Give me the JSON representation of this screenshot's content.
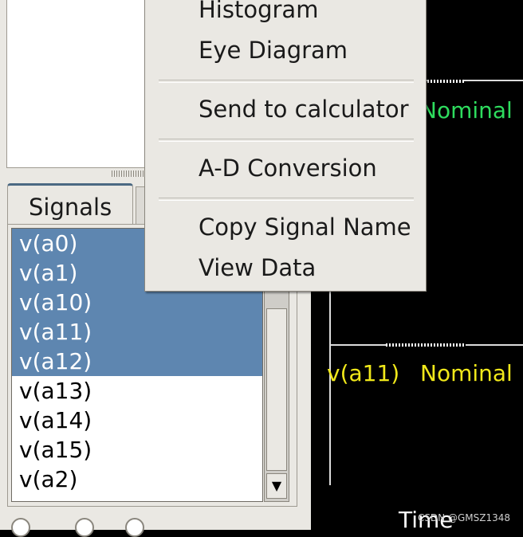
{
  "signal_panel": {
    "tab_label": "Signals",
    "signals": [
      {
        "label": "v(a0)",
        "selected": true
      },
      {
        "label": "v(a1)",
        "selected": true
      },
      {
        "label": "v(a10)",
        "selected": true
      },
      {
        "label": "v(a11)",
        "selected": true
      },
      {
        "label": "v(a12)",
        "selected": true
      },
      {
        "label": "v(a13)",
        "selected": false
      },
      {
        "label": "v(a14)",
        "selected": false
      },
      {
        "label": "v(a15)",
        "selected": false
      },
      {
        "label": "v(a2)",
        "selected": false
      }
    ],
    "scroll_down_icon": "arrow-down"
  },
  "context_menu": {
    "items": [
      "Histogram",
      "Eye Diagram",
      "Send to calculator",
      "A-D Conversion",
      "Copy Signal Name",
      "View Data"
    ]
  },
  "waveforms": {
    "upper_label": "Nominal",
    "lower_signal": "v(a11)",
    "lower_label": "Nominal",
    "x_axis_label": "Time"
  },
  "watermark": "CSDN @GMSZ1348",
  "colors": {
    "selection": "#5e86b0",
    "nominal_green": "#2edc5e",
    "nominal_yellow": "#f0e81a",
    "background": "#000000",
    "panel": "#eae8e3"
  }
}
